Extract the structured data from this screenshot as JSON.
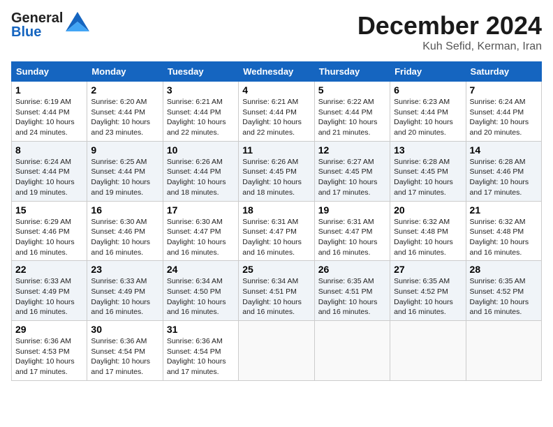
{
  "header": {
    "logo_general": "General",
    "logo_blue": "Blue",
    "month_title": "December 2024",
    "subtitle": "Kuh Sefid, Kerman, Iran"
  },
  "days_of_week": [
    "Sunday",
    "Monday",
    "Tuesday",
    "Wednesday",
    "Thursday",
    "Friday",
    "Saturday"
  ],
  "weeks": [
    [
      {
        "day": "1",
        "sunrise": "6:19 AM",
        "sunset": "4:44 PM",
        "daylight": "10 hours and 24 minutes."
      },
      {
        "day": "2",
        "sunrise": "6:20 AM",
        "sunset": "4:44 PM",
        "daylight": "10 hours and 23 minutes."
      },
      {
        "day": "3",
        "sunrise": "6:21 AM",
        "sunset": "4:44 PM",
        "daylight": "10 hours and 22 minutes."
      },
      {
        "day": "4",
        "sunrise": "6:21 AM",
        "sunset": "4:44 PM",
        "daylight": "10 hours and 22 minutes."
      },
      {
        "day": "5",
        "sunrise": "6:22 AM",
        "sunset": "4:44 PM",
        "daylight": "10 hours and 21 minutes."
      },
      {
        "day": "6",
        "sunrise": "6:23 AM",
        "sunset": "4:44 PM",
        "daylight": "10 hours and 20 minutes."
      },
      {
        "day": "7",
        "sunrise": "6:24 AM",
        "sunset": "4:44 PM",
        "daylight": "10 hours and 20 minutes."
      }
    ],
    [
      {
        "day": "8",
        "sunrise": "6:24 AM",
        "sunset": "4:44 PM",
        "daylight": "10 hours and 19 minutes."
      },
      {
        "day": "9",
        "sunrise": "6:25 AM",
        "sunset": "4:44 PM",
        "daylight": "10 hours and 19 minutes."
      },
      {
        "day": "10",
        "sunrise": "6:26 AM",
        "sunset": "4:44 PM",
        "daylight": "10 hours and 18 minutes."
      },
      {
        "day": "11",
        "sunrise": "6:26 AM",
        "sunset": "4:45 PM",
        "daylight": "10 hours and 18 minutes."
      },
      {
        "day": "12",
        "sunrise": "6:27 AM",
        "sunset": "4:45 PM",
        "daylight": "10 hours and 17 minutes."
      },
      {
        "day": "13",
        "sunrise": "6:28 AM",
        "sunset": "4:45 PM",
        "daylight": "10 hours and 17 minutes."
      },
      {
        "day": "14",
        "sunrise": "6:28 AM",
        "sunset": "4:46 PM",
        "daylight": "10 hours and 17 minutes."
      }
    ],
    [
      {
        "day": "15",
        "sunrise": "6:29 AM",
        "sunset": "4:46 PM",
        "daylight": "10 hours and 16 minutes."
      },
      {
        "day": "16",
        "sunrise": "6:30 AM",
        "sunset": "4:46 PM",
        "daylight": "10 hours and 16 minutes."
      },
      {
        "day": "17",
        "sunrise": "6:30 AM",
        "sunset": "4:47 PM",
        "daylight": "10 hours and 16 minutes."
      },
      {
        "day": "18",
        "sunrise": "6:31 AM",
        "sunset": "4:47 PM",
        "daylight": "10 hours and 16 minutes."
      },
      {
        "day": "19",
        "sunrise": "6:31 AM",
        "sunset": "4:47 PM",
        "daylight": "10 hours and 16 minutes."
      },
      {
        "day": "20",
        "sunrise": "6:32 AM",
        "sunset": "4:48 PM",
        "daylight": "10 hours and 16 minutes."
      },
      {
        "day": "21",
        "sunrise": "6:32 AM",
        "sunset": "4:48 PM",
        "daylight": "10 hours and 16 minutes."
      }
    ],
    [
      {
        "day": "22",
        "sunrise": "6:33 AM",
        "sunset": "4:49 PM",
        "daylight": "10 hours and 16 minutes."
      },
      {
        "day": "23",
        "sunrise": "6:33 AM",
        "sunset": "4:49 PM",
        "daylight": "10 hours and 16 minutes."
      },
      {
        "day": "24",
        "sunrise": "6:34 AM",
        "sunset": "4:50 PM",
        "daylight": "10 hours and 16 minutes."
      },
      {
        "day": "25",
        "sunrise": "6:34 AM",
        "sunset": "4:51 PM",
        "daylight": "10 hours and 16 minutes."
      },
      {
        "day": "26",
        "sunrise": "6:35 AM",
        "sunset": "4:51 PM",
        "daylight": "10 hours and 16 minutes."
      },
      {
        "day": "27",
        "sunrise": "6:35 AM",
        "sunset": "4:52 PM",
        "daylight": "10 hours and 16 minutes."
      },
      {
        "day": "28",
        "sunrise": "6:35 AM",
        "sunset": "4:52 PM",
        "daylight": "10 hours and 16 minutes."
      }
    ],
    [
      {
        "day": "29",
        "sunrise": "6:36 AM",
        "sunset": "4:53 PM",
        "daylight": "10 hours and 17 minutes."
      },
      {
        "day": "30",
        "sunrise": "6:36 AM",
        "sunset": "4:54 PM",
        "daylight": "10 hours and 17 minutes."
      },
      {
        "day": "31",
        "sunrise": "6:36 AM",
        "sunset": "4:54 PM",
        "daylight": "10 hours and 17 minutes."
      },
      null,
      null,
      null,
      null
    ]
  ]
}
